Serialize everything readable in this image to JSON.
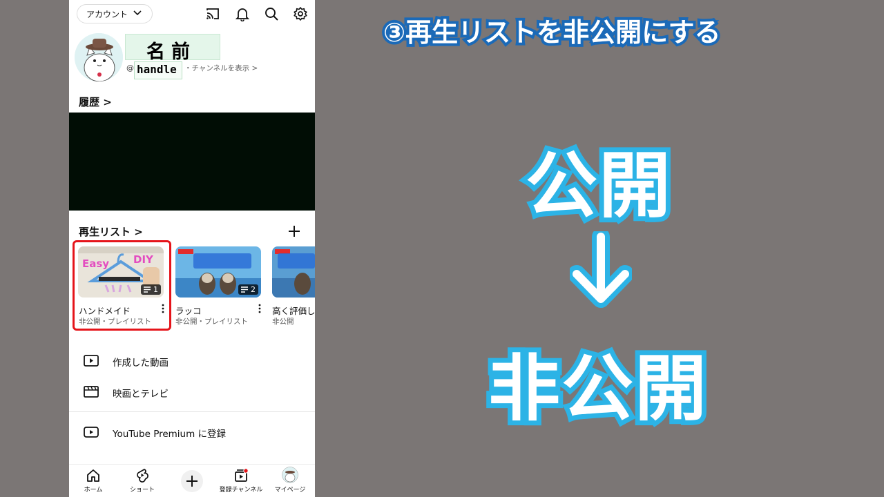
{
  "phone": {
    "account_button": "アカウント",
    "top_icons": [
      "cast-icon",
      "bell-icon",
      "search-icon",
      "gear-icon"
    ],
    "profile": {
      "name": "名前",
      "handle_prefix": "@",
      "handle": "handle",
      "channel_link": "・チャンネルを表示 >"
    },
    "history": {
      "title": "履歴 >"
    },
    "playlists": {
      "title": "再生リスト >",
      "items": [
        {
          "title": "ハンドメイド",
          "subtitle": "非公開・プレイリスト",
          "count": "1",
          "thumb_text_left": "Easy",
          "thumb_text_right": "DIY"
        },
        {
          "title": "ラッコ",
          "subtitle": "非公開・プレイリスト",
          "count": "2"
        },
        {
          "title": "高く評価し",
          "subtitle": "非公開"
        }
      ]
    },
    "menu": [
      {
        "label": "作成した動画",
        "icon": "video-play-icon"
      },
      {
        "label": "映画とテレビ",
        "icon": "clapper-icon"
      },
      {
        "label": "YouTube Premium に登録",
        "icon": "youtube-icon"
      }
    ],
    "bottom_nav": [
      {
        "label": "ホーム",
        "icon": "home-icon"
      },
      {
        "label": "ショート",
        "icon": "shorts-icon"
      },
      {
        "label": "",
        "icon": "create-plus-icon"
      },
      {
        "label": "登録チャンネル",
        "icon": "subscriptions-icon"
      },
      {
        "label": "マイページ",
        "icon": "avatar-icon"
      }
    ]
  },
  "overlay": {
    "headline": "③再生リストを非公開にする",
    "from_label": "公開",
    "arrow": "↓",
    "to_label": "非公開",
    "colors": {
      "outline": "#2cb3e6",
      "headline_outline": "#1b6ab8",
      "background": "#7b7675",
      "highlight": "#e5141a"
    }
  }
}
